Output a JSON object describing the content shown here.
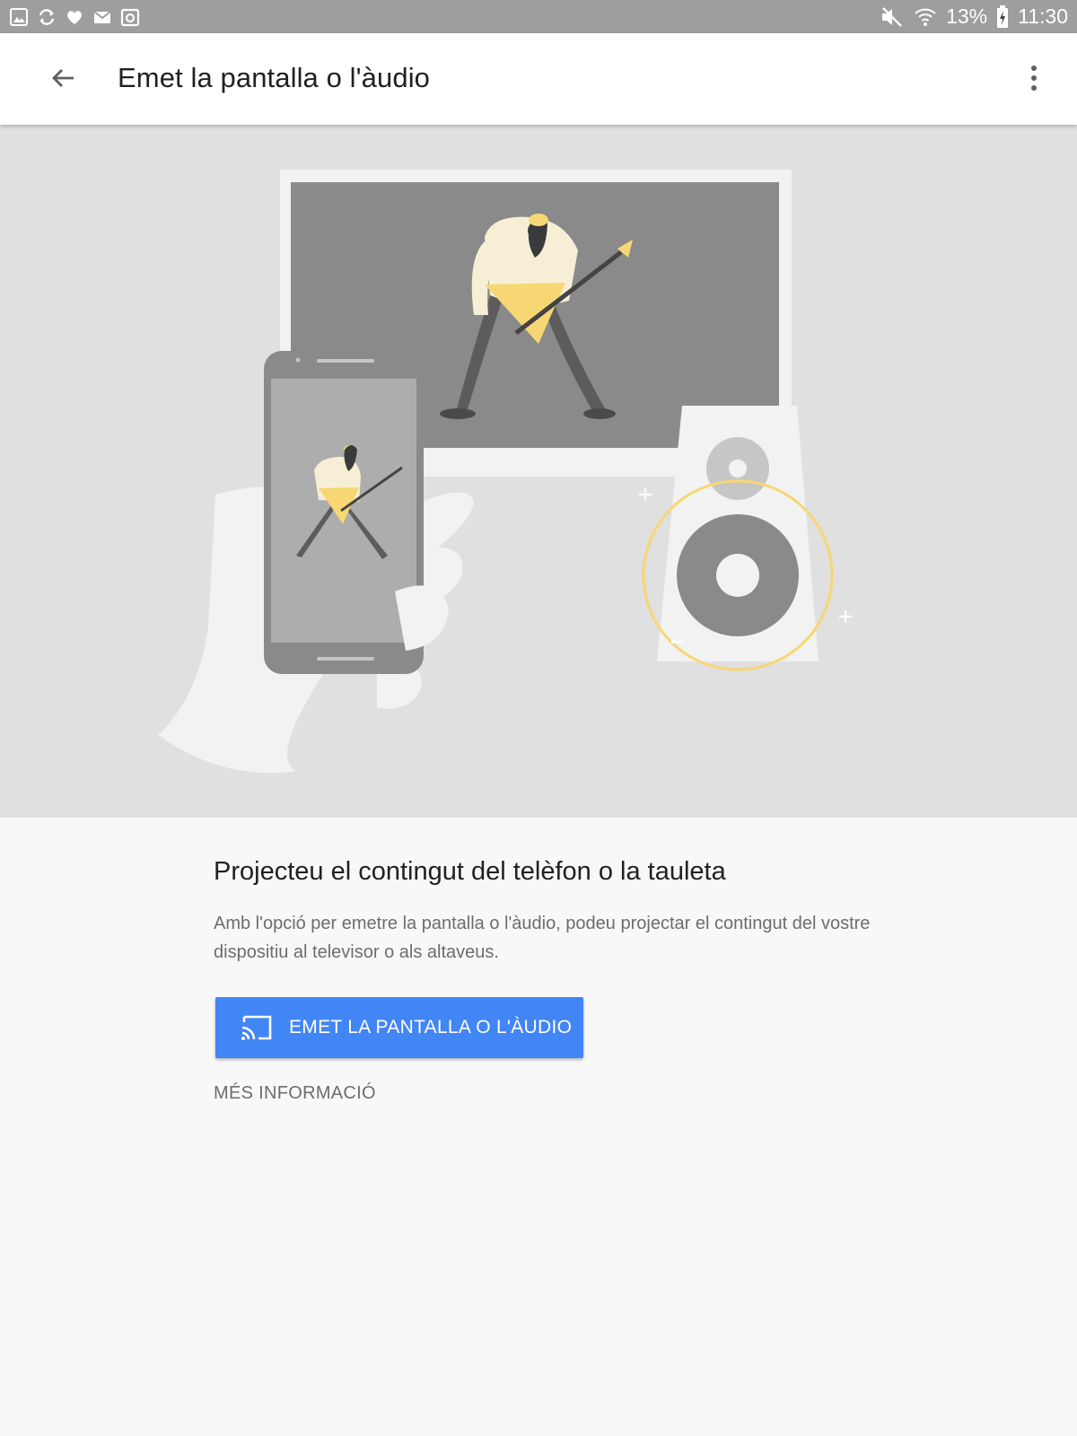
{
  "status_bar": {
    "icons": [
      "gallery-icon",
      "sync-icon",
      "heart-icon",
      "mail-icon",
      "camera-icon",
      "mute-icon",
      "wifi-icon",
      "battery-icon"
    ],
    "battery": "13%",
    "time": "11:30"
  },
  "app_bar": {
    "title": "Emet la pantalla o l'àudio",
    "back_icon": "arrow-back-icon",
    "menu_icon": "more-vert-icon"
  },
  "hero": {
    "illustration": "cast-illustration"
  },
  "main": {
    "heading": "Projecteu el contingut del telèfon o la tauleta",
    "description": "Amb l'opció per emetre la pantalla o l'àudio, podeu projectar el contingut del vostre dispositiu al televisor o als altaveus.",
    "cast_button": {
      "label": "EMET LA PANTALLA O L'ÀUDIO",
      "icon": "cast-icon"
    },
    "more_info": "MÉS INFORMACIÓ"
  },
  "colors": {
    "status_bar": "#9e9e9e",
    "app_bar": "#ffffff",
    "hero_background": "#e0e0e0",
    "primary_button": "#4285f4",
    "accent_yellow": "#f7d774",
    "page_background": "#f8f8f8"
  }
}
